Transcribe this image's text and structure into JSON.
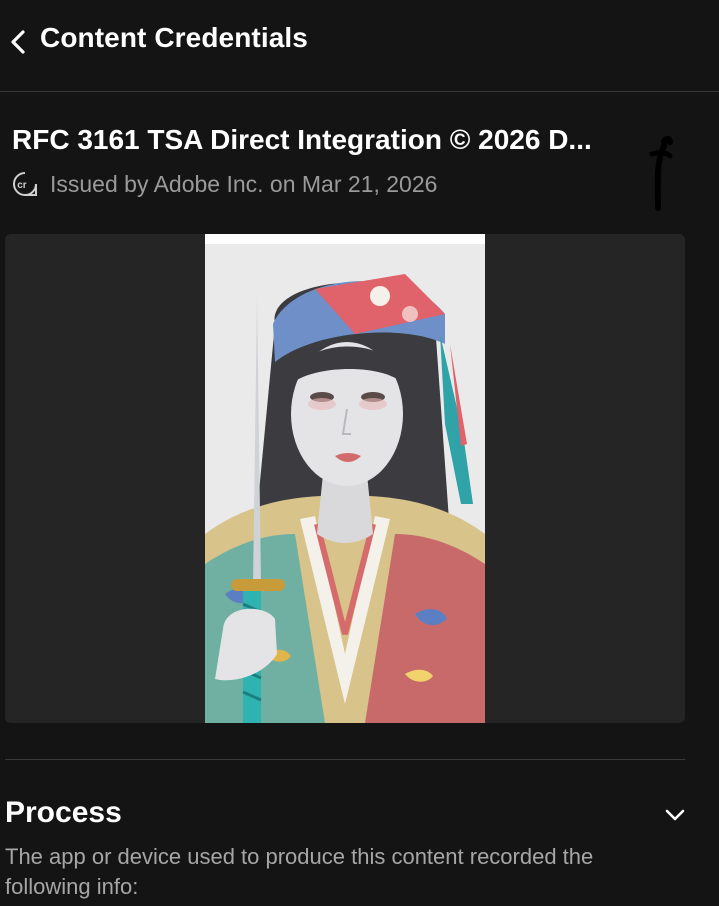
{
  "header": {
    "title": "Content Credentials",
    "back_icon": "chevron-left-icon"
  },
  "credential": {
    "title": "RFC 3161 TSA Direct Integration © 2026 D...",
    "issuer_text": "Issued by Adobe Inc. on Mar 21, 2026",
    "issuer_icon": "cr-badge-icon"
  },
  "preview": {
    "image_label": "content-thumbnail"
  },
  "process": {
    "title": "Process",
    "description": "The app or device used to produce this content recorded the following info:",
    "toggle_icon": "chevron-down-icon"
  },
  "colors": {
    "background": "#141414",
    "panel": "#252525",
    "muted_text": "#9a9a9a",
    "divider": "#3a3a3a"
  }
}
